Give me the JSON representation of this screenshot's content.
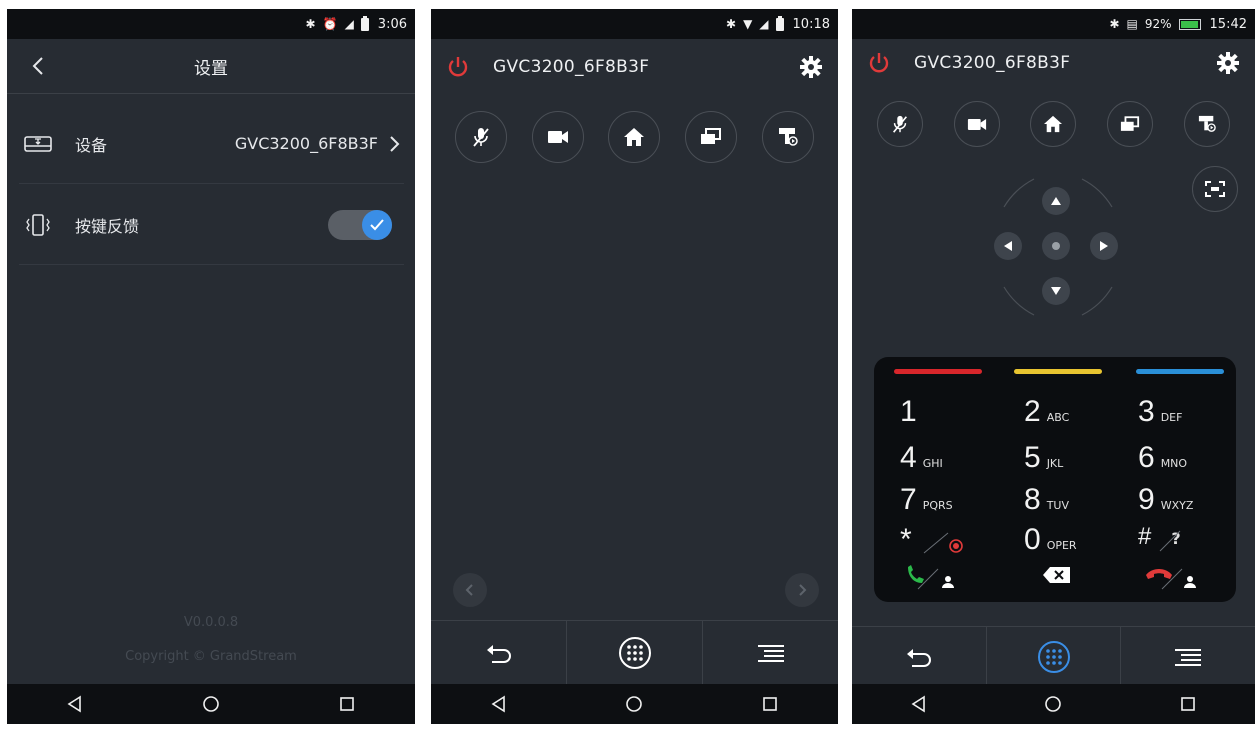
{
  "screen1": {
    "status": {
      "time": "3:06"
    },
    "header": {
      "title": "设置"
    },
    "device_row": {
      "label": "设备",
      "value": "GVC3200_6F8B3F"
    },
    "feedback_row": {
      "label": "按键反馈",
      "toggle_on": true
    },
    "version": "V0.0.0.8",
    "copyright": "Copyright © GrandStream"
  },
  "screen2": {
    "status": {
      "time": "10:18"
    },
    "header": {
      "device_name": "GVC3200_6F8B3F"
    }
  },
  "screen3": {
    "status": {
      "battery": "92%",
      "time": "15:42"
    },
    "header": {
      "device_name": "GVC3200_6F8B3F"
    },
    "keypad": {
      "color_keys": [
        "#d8262b",
        "#e8c430",
        "#2a8fd8"
      ],
      "keys": [
        {
          "digit": "1",
          "letters": ""
        },
        {
          "digit": "2",
          "letters": "ABC"
        },
        {
          "digit": "3",
          "letters": "DEF"
        },
        {
          "digit": "4",
          "letters": "GHI"
        },
        {
          "digit": "5",
          "letters": "JKL"
        },
        {
          "digit": "6",
          "letters": "MNO"
        },
        {
          "digit": "7",
          "letters": "PQRS"
        },
        {
          "digit": "8",
          "letters": "TUV"
        },
        {
          "digit": "9",
          "letters": "WXYZ"
        },
        {
          "digit": "*",
          "letters": ""
        },
        {
          "digit": "0",
          "letters": "OPER"
        },
        {
          "digit": "#",
          "letters": "?"
        }
      ]
    }
  },
  "colors": {
    "background": "#272c33",
    "bars": "#0d0f12",
    "accent_blue": "#3a8ee6",
    "power_red": "#e03a3a"
  }
}
